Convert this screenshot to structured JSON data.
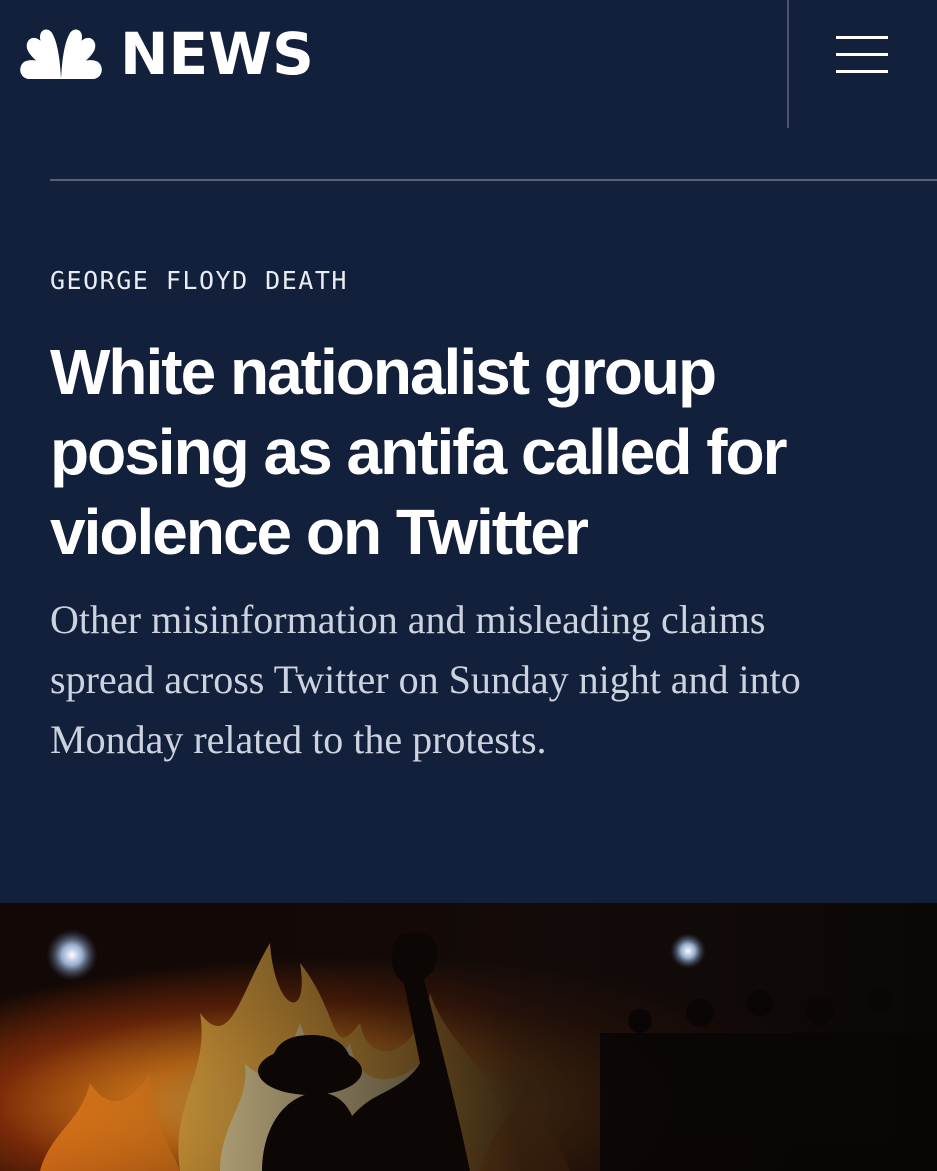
{
  "brand": {
    "wordmark": "NEWS",
    "logo_icon": "nbc-peacock-icon"
  },
  "nav": {
    "menu_icon": "hamburger-menu-icon"
  },
  "article": {
    "section_label": "GEORGE FLOYD DEATH",
    "headline": "White nationalist group posing as antifa called for violence on Twitter",
    "dek": "Other misinformation and misleading claims spread across Twitter on Sunday night and into Monday related to the protests."
  },
  "colors": {
    "background": "#13203b",
    "divider": "#57627a",
    "text_primary": "#ffffff",
    "text_secondary": "#cdd3de",
    "fire": "#ff9a2a"
  }
}
